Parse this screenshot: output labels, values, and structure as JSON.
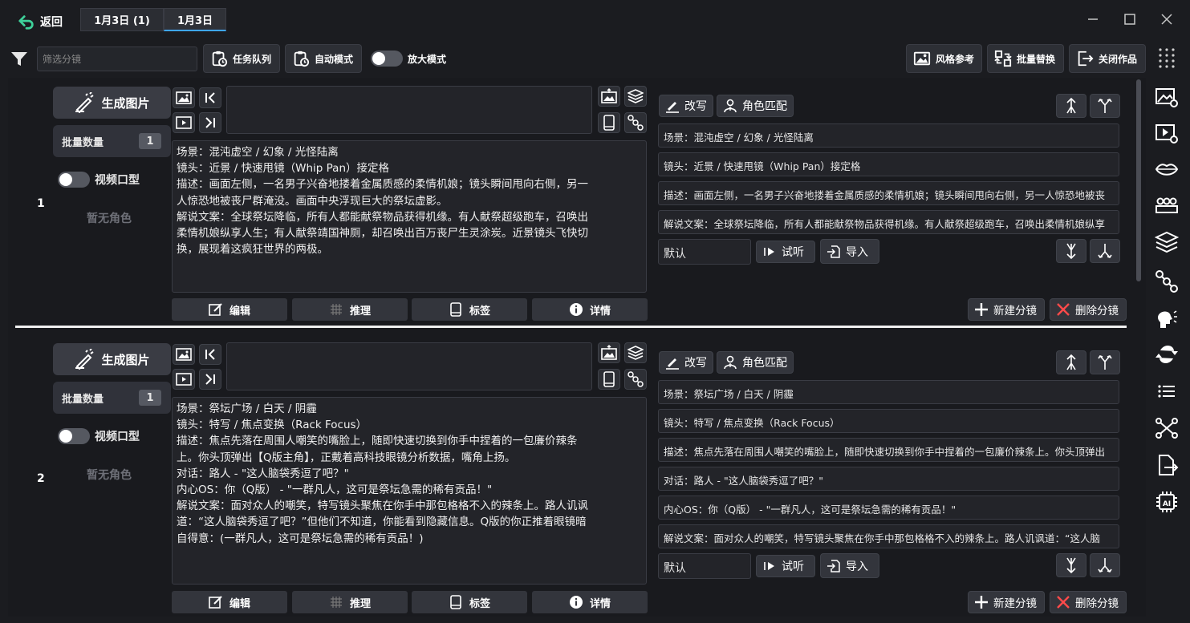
{
  "header": {
    "back_label": "返回",
    "tabs": [
      {
        "label": "1月3日 (1)",
        "active": false
      },
      {
        "label": "1月3日",
        "active": true
      }
    ]
  },
  "toolbar": {
    "filter_placeholder": "筛选分镜",
    "task_queue_label": "任务队列",
    "auto_mode_label": "自动模式",
    "zoom_mode_label": "放大模式",
    "style_ref_label": "风格参考",
    "batch_replace_label": "批量替换",
    "close_work_label": "关闭作品"
  },
  "colors": {
    "accent": "#3ea6ff",
    "background": "#1b1c20",
    "panel": "#232429",
    "delete": "#ff4a4a"
  },
  "rows": [
    {
      "number": "1",
      "gen_label": "生成图片",
      "batch_label": "批量数量",
      "batch_value": "1",
      "video_label": "视频口型",
      "no_role": "暂无角色",
      "desc_lines": [
        "场景：混沌虚空 / 幻象 / 光怪陆离",
        "镜头：近景 / 快速甩镜（Whip Pan）接定格",
        "描述：画面左侧，一名男子兴奋地搂着金属质感的柔情机娘；镜头瞬间甩向右侧，另一",
        "人惊恐地被丧尸群淹没。画面中央浮现巨大的祭坛虚影。",
        "解说文案：全球祭坛降临，所有人都能献祭物品获得机缘。有人献祭超级跑车，召唤出",
        "柔情机娘纵享人生；有人献祭靖国神厕，却召唤出百万丧尸生灵涂炭。近景镜头飞快切",
        "换，展现着这疯狂世界的两极。"
      ],
      "actions": {
        "edit": "编辑",
        "infer": "推理",
        "tag": "标签",
        "detail": "详情"
      },
      "rewrite_label": "改写",
      "role_match_label": "角色匹配",
      "fields": [
        "场景：混沌虚空 / 幻象 / 光怪陆离",
        "镜头：近景 / 快速甩镜（Whip Pan）接定格",
        "描述：画面左侧，一名男子兴奋地搂着金属质感的柔情机娘；镜头瞬间甩向右侧，另一人惊恐地被丧",
        "解说文案：全球祭坛降临，所有人都能献祭物品获得机缘。有人献祭超级跑车，召唤出柔情机娘纵享"
      ],
      "voice": "默认",
      "listen_label": "试听",
      "import_label": "导入",
      "new_shot_label": "新建分镜",
      "delete_shot_label": "删除分镜"
    },
    {
      "number": "2",
      "gen_label": "生成图片",
      "batch_label": "批量数量",
      "batch_value": "1",
      "video_label": "视频口型",
      "no_role": "暂无角色",
      "desc_lines": [
        "场景：祭坛广场 / 白天 / 阴霾",
        "镜头：特写 / 焦点变换（Rack Focus）",
        "描述：焦点先落在周围人嘲笑的嘴脸上，随即快速切换到你手中捏着的一包廉价辣条",
        "上。你头顶弹出【Q版主角】，正戴着高科技眼镜分析数据，嘴角上扬。",
        "对话：路人 - \"这人脑袋秀逗了吧？\"",
        "内心OS：你（Q版） - \"一群凡人，这可是祭坛急需的稀有贡品！\"",
        "解说文案：面对众人的嘲笑，特写镜头聚焦在你手中那包格格不入的辣条上。路人讥讽",
        "道：“这人脑袋秀逗了吧？”但他们不知道，你能看到隐藏信息。Q版的你正推着眼镜暗",
        "自得意：(一群凡人，这可是祭坛急需的稀有贡品！)"
      ],
      "actions": {
        "edit": "编辑",
        "infer": "推理",
        "tag": "标签",
        "detail": "详情"
      },
      "rewrite_label": "改写",
      "role_match_label": "角色匹配",
      "fields": [
        "场景：祭坛广场 / 白天 / 阴霾",
        "镜头：特写 / 焦点变换（Rack Focus）",
        "描述：焦点先落在周围人嘲笑的嘴脸上，随即快速切换到你手中捏着的一包廉价辣条上。你头顶弹出",
        "对话：路人 - \"这人脑袋秀逗了吧？\"",
        "内心OS：你（Q版） - \"一群凡人，这可是祭坛急需的稀有贡品！\"",
        "解说文案：面对众人的嘲笑，特写镜头聚焦在你手中那包格格不入的辣条上。路人讥讽道：“这人脑"
      ],
      "voice": "默认",
      "listen_label": "试听",
      "import_label": "导入",
      "new_shot_label": "新建分镜",
      "delete_shot_label": "删除分镜"
    }
  ]
}
